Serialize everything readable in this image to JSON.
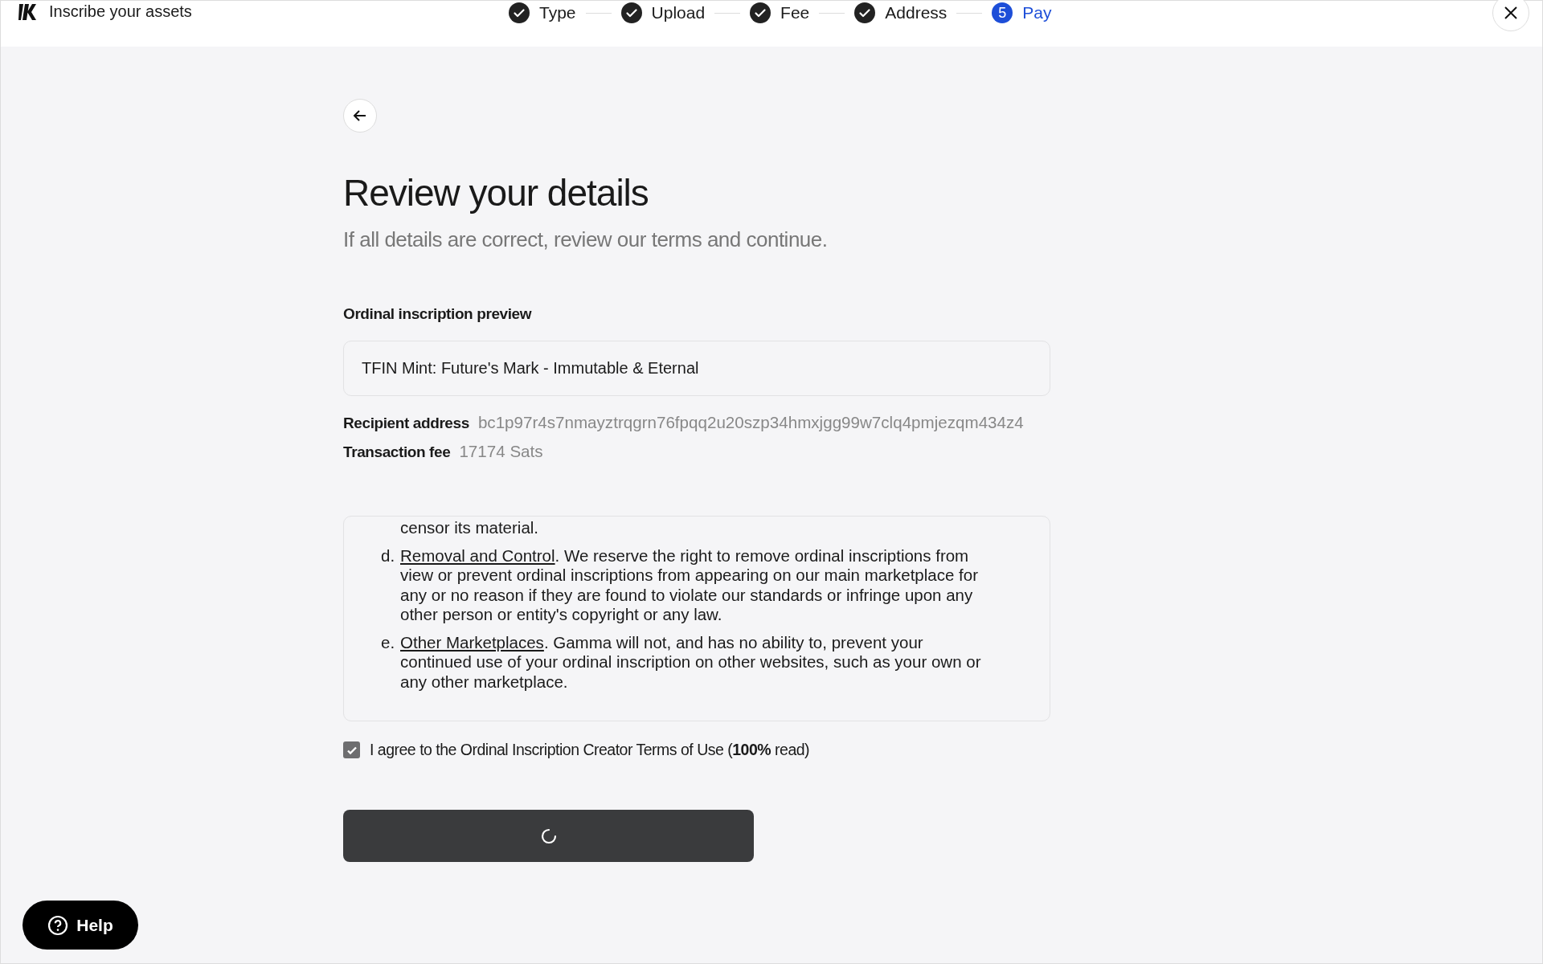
{
  "header": {
    "title": "Inscribe your assets"
  },
  "steps": [
    {
      "label": "Type",
      "kind": "done"
    },
    {
      "label": "Upload",
      "kind": "done"
    },
    {
      "label": "Fee",
      "kind": "done"
    },
    {
      "label": "Address",
      "kind": "done"
    },
    {
      "label": "Pay",
      "number": "5",
      "kind": "current"
    }
  ],
  "page": {
    "title": "Review your details",
    "subtitle": "If all details are correct, review our terms and continue."
  },
  "preview": {
    "label": "Ordinal inscription preview",
    "value": "TFIN Mint: Future's Mark - Immutable & Eternal"
  },
  "details": [
    {
      "label": "Recipient address",
      "value": "bc1p97r4s7nmayztrqgrn76fpqq2u20szp34hmxjgg99w7clq4pmjezqm434z4"
    },
    {
      "label": "Transaction fee",
      "value": "17174 Sats"
    }
  ],
  "terms": {
    "fragment": "censor its material.",
    "items": [
      {
        "marker": "d.",
        "link": "Removal and Control",
        "text": ". We reserve the right to remove ordinal inscriptions from view or prevent ordinal inscriptions from appearing on our main marketplace for any or no reason if they are found to violate our standards or infringe upon any other person or entity's copyright or any law."
      },
      {
        "marker": "e.",
        "link": "Other Marketplaces",
        "text": ". Gamma will not, and has no ability to, prevent your continued use of your ordinal inscription on other websites, such as your own or any other marketplace."
      }
    ]
  },
  "agree": {
    "label": "I agree to the Ordinal Inscription Creator Terms of Use (**100%** read)",
    "checked": true
  },
  "submit": {
    "loading": true
  },
  "help": {
    "label": "Help"
  }
}
